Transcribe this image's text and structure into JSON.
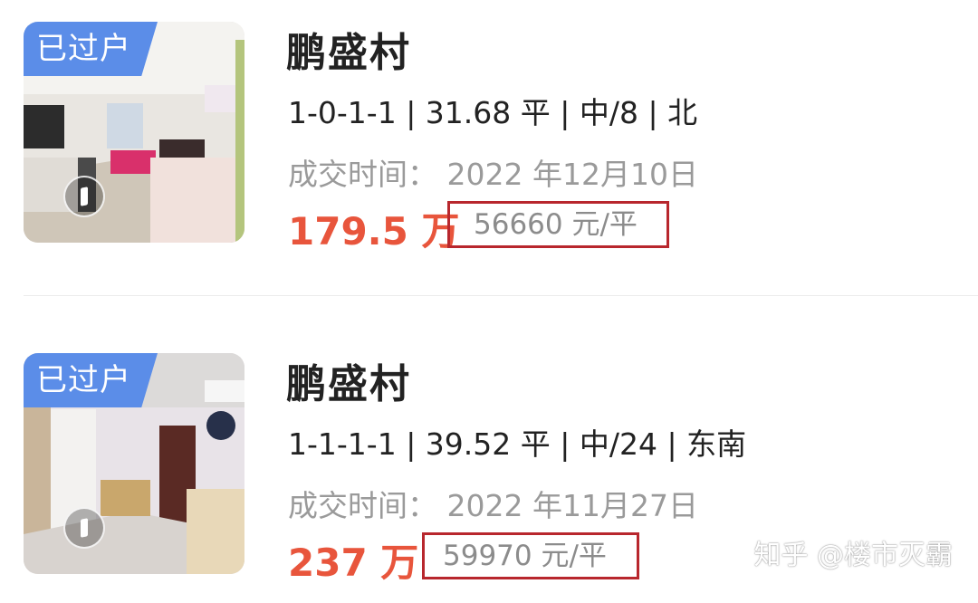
{
  "listings": [
    {
      "badge": "已过户",
      "title": "鹏盛村",
      "specs": "1-0-1-1 | 31.68 平 | 中/8 | 北",
      "deal_time": "成交时间： 2022 年12月10日",
      "total_price": "179.5 万",
      "unit_price": "56660 元/平"
    },
    {
      "badge": "已过户",
      "title": "鹏盛村",
      "specs": "1-1-1-1 | 39.52 平 | 中/24 | 东南",
      "deal_time": "成交时间： 2022 年11月27日",
      "total_price": "237 万",
      "unit_price": "59970 元/平"
    }
  ],
  "watermark": "知乎 @楼市灭霸",
  "colors": {
    "badge_bg": "#5b8de8",
    "price_red": "#e8553c",
    "highlight_box": "#b8272d",
    "muted_text": "#9a9a9a"
  },
  "icons": [
    "vr-tour-icon"
  ]
}
